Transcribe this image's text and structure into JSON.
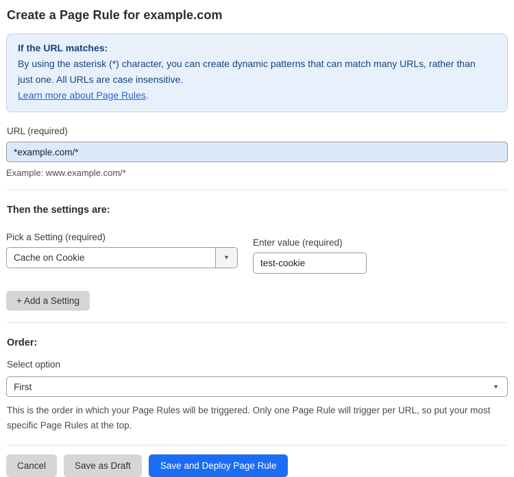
{
  "page": {
    "title": "Create a Page Rule for example.com"
  },
  "info_banner": {
    "heading": "If the URL matches:",
    "body": "By using the asterisk (*) character, you can create dynamic patterns that can match many URLs, rather than just one. All URLs are case insensitive.",
    "link_label": "Learn more about Page Rules",
    "link_suffix": "."
  },
  "url_field": {
    "label": "URL (required)",
    "value": "*example.com/*",
    "example": "Example: www.example.com/*"
  },
  "settings": {
    "heading": "Then the settings are:",
    "setting_label": "Pick a Setting (required)",
    "setting_selected": "Cache on Cookie",
    "value_label": "Enter value (required)",
    "value_text": "test-cookie",
    "add_button_label": "+ Add a Setting"
  },
  "order": {
    "heading": "Order:",
    "select_label": "Select option",
    "selected_option": "First",
    "help_text": "This is the order in which your Page Rules will be triggered. Only one Page Rule will trigger per URL, so put your most specific Page Rules at the top."
  },
  "footer": {
    "cancel_label": "Cancel",
    "save_draft_label": "Save as Draft",
    "save_deploy_label": "Save and Deploy Page Rule"
  },
  "icons": {
    "dropdown_arrow": "▼"
  },
  "colors": {
    "accent_blue": "#1b6ef3",
    "banner_bg": "#e8f1fb",
    "banner_border": "#b9d3ee",
    "banner_text": "#15417e",
    "link_blue": "#2b64c9",
    "url_input_bg": "#dbe9fb",
    "button_gray": "#d6d6d6"
  }
}
